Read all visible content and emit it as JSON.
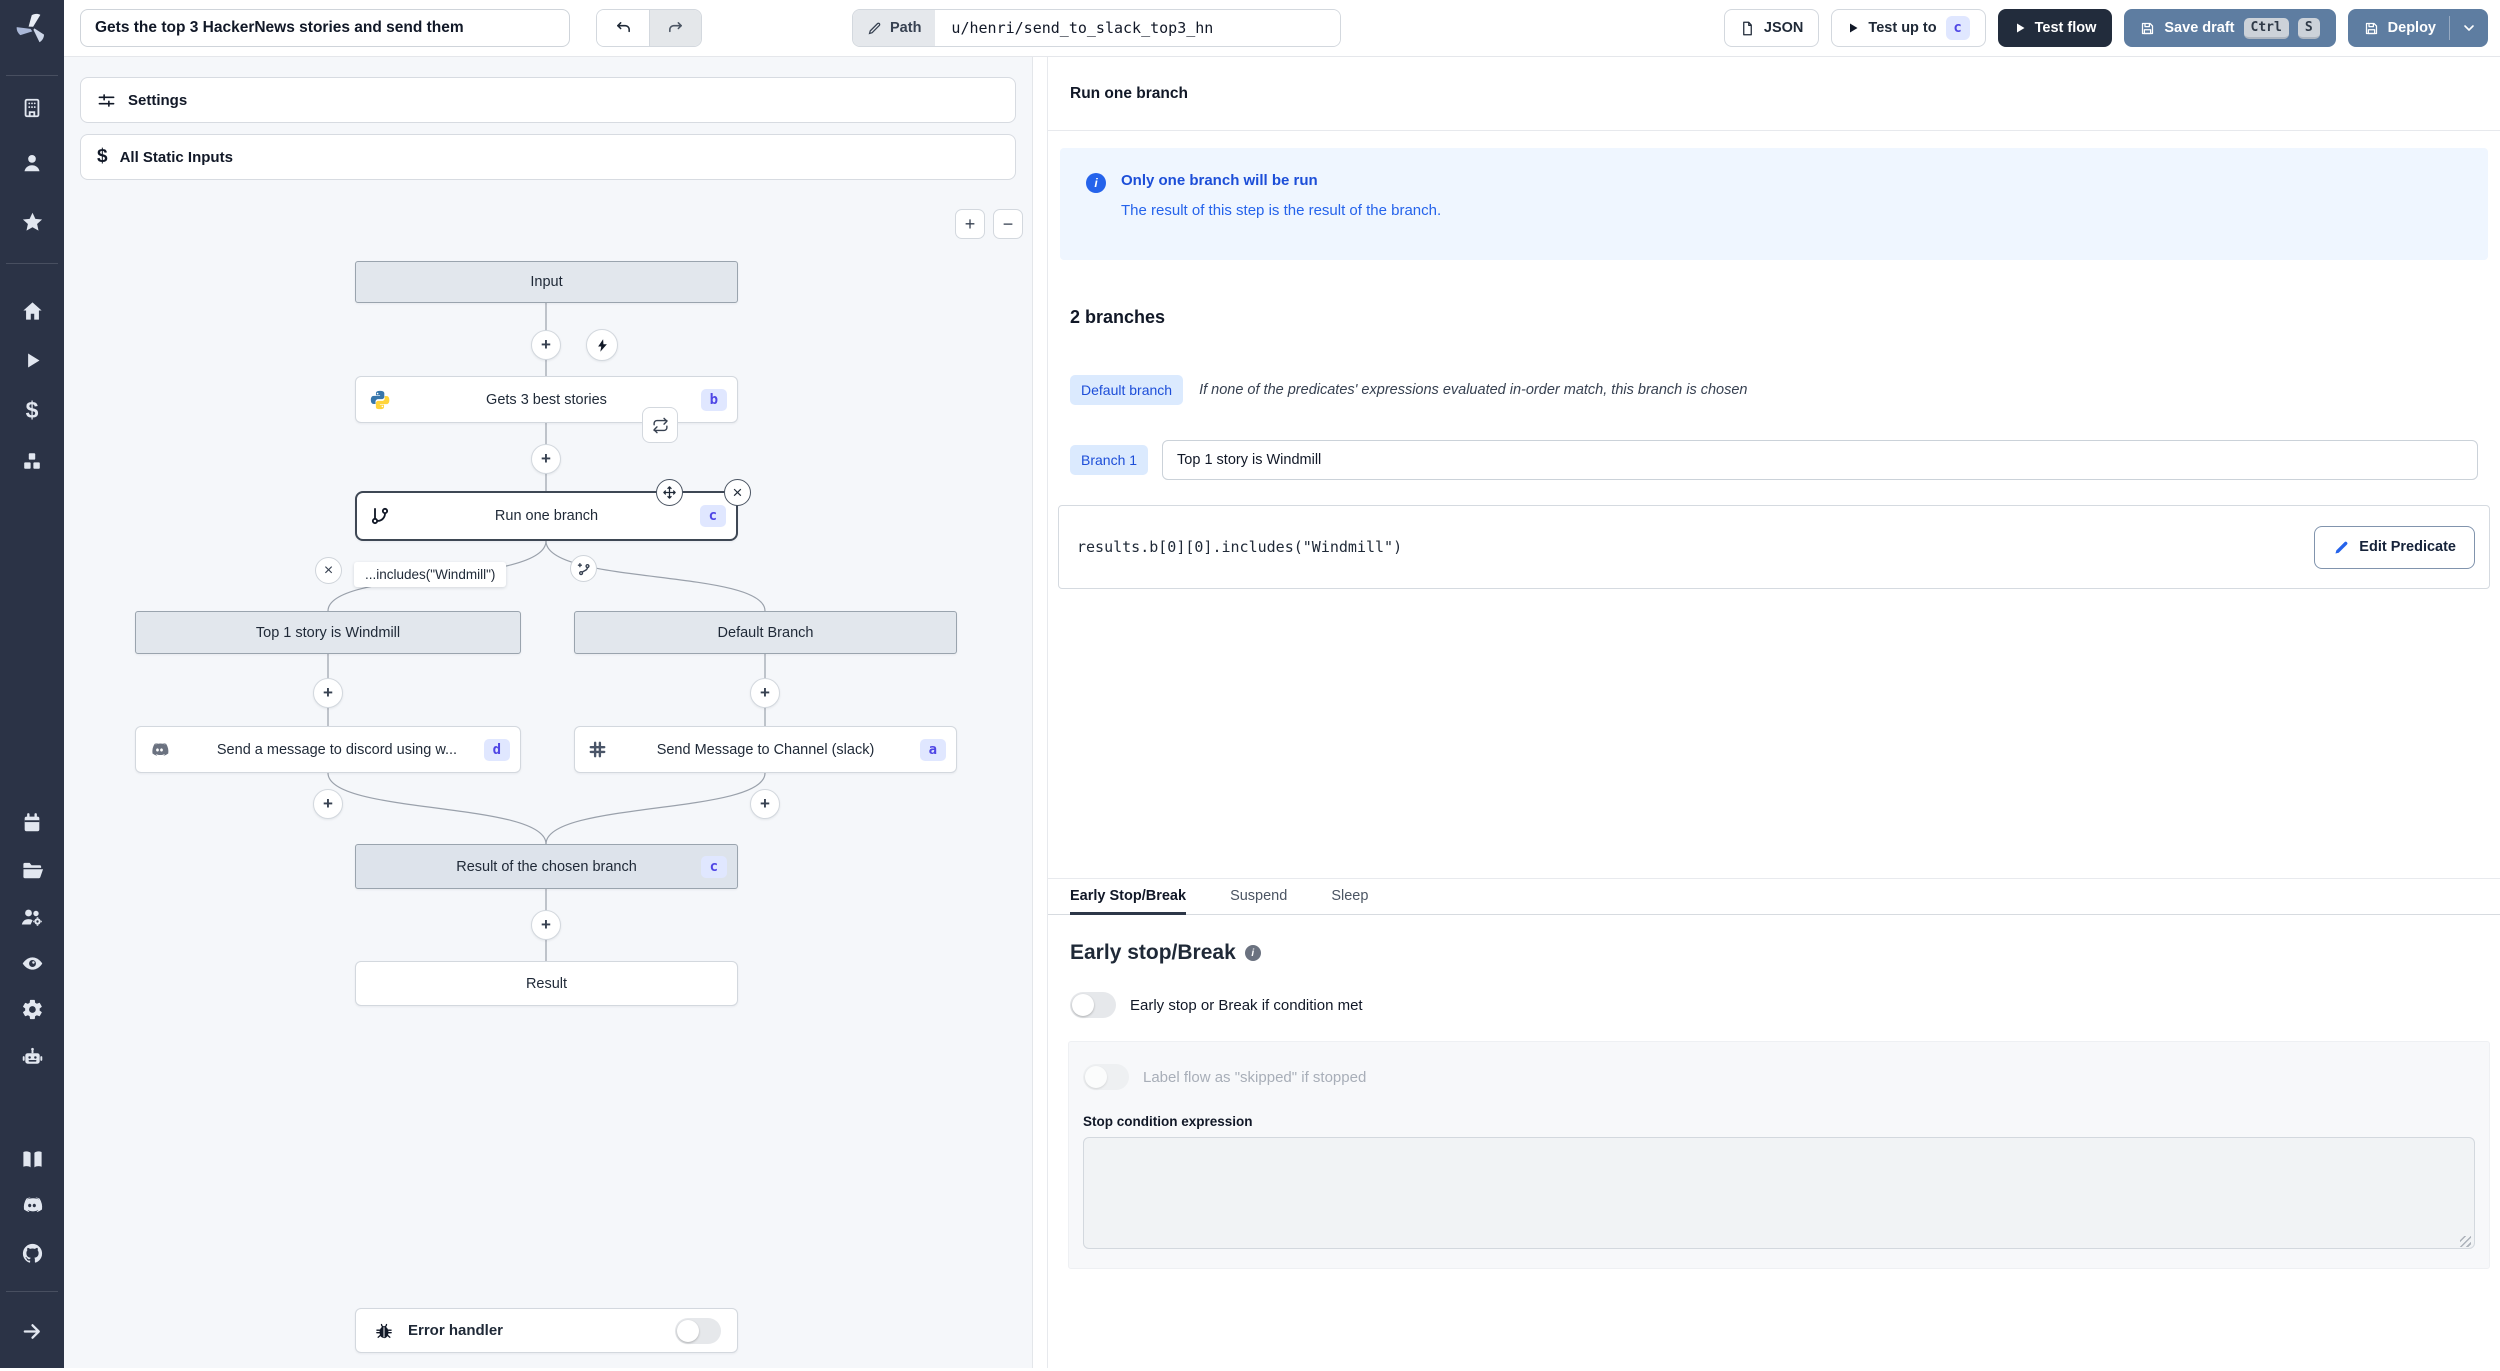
{
  "topbar": {
    "flow_title": "Gets the top 3 HackerNews stories and send them",
    "path_label": "Path",
    "path_value": "u/henri/send_to_slack_top3_hn",
    "json_button": "JSON",
    "test_up_to": "Test up to",
    "test_up_to_badge": "c",
    "test_flow": "Test flow",
    "save_draft": "Save draft",
    "shortcut_ctrl": "Ctrl",
    "shortcut_s": "S",
    "deploy": "Deploy"
  },
  "flow_panel": {
    "settings_bar": "Settings",
    "static_inputs_bar": "All Static Inputs",
    "nodes": {
      "input": "Input",
      "step_b": "Gets 3 best stories",
      "step_b_badge": "b",
      "branch_node": "Run one branch",
      "branch_node_badge": "c",
      "predicate_edge_label": "...includes(\"Windmill\")",
      "branch_left": "Top 1 story is Windmill",
      "branch_right": "Default Branch",
      "step_d": "Send a message to discord using w...",
      "step_d_badge": "d",
      "step_a": "Send Message to Channel (slack)",
      "step_a_badge": "a",
      "collect": "Result of the chosen branch",
      "collect_badge": "c",
      "result": "Result",
      "error_handler": "Error handler"
    }
  },
  "right_panel": {
    "title": "Run one branch",
    "info_title": "Only one branch will be run",
    "info_body": "The result of this step is the result of the branch.",
    "branches_heading": "2 branches",
    "default_branch_pill": "Default branch",
    "default_branch_desc": "If none of the predicates' expressions evaluated in-order match, this branch is chosen",
    "branch1_pill": "Branch 1",
    "branch1_value": "Top 1 story is Windmill",
    "predicate_code": "results.b[0][0].includes(\"Windmill\")",
    "edit_predicate": "Edit Predicate",
    "tabs": [
      {
        "label": "Early Stop/Break",
        "active": true
      },
      {
        "label": "Suspend",
        "active": false
      },
      {
        "label": "Sleep",
        "active": false
      }
    ],
    "early_stop": {
      "heading": "Early stop/Break",
      "toggle1_label": "Early stop or Break if condition met",
      "toggle2_label": "Label flow as \"skipped\" if stopped",
      "stop_condition_label": "Stop condition expression"
    }
  },
  "icons": {
    "plus": "+",
    "minus": "−",
    "close": "×",
    "dollar": "$",
    "info": "i"
  },
  "colors": {
    "sidebar_bg": "#2b3346",
    "dark_button": "#222c3c",
    "steel_blue_button": "#5e7da1",
    "badge_bg": "#e0e7ff",
    "badge_text": "#4f46e5",
    "info_bg": "#eff6ff",
    "info_text": "#1d4ed8",
    "pill_bg": "#dbeafe",
    "canvas_bg": "#f5f7fa",
    "node_gray_bg": "#e2e7ed"
  }
}
